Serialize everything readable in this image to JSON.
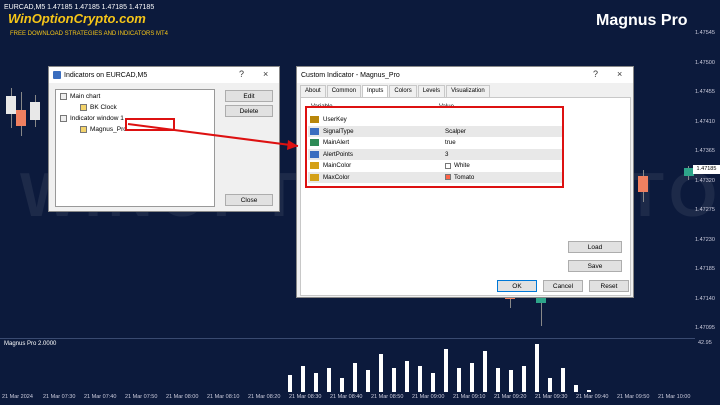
{
  "chart": {
    "symbol_line": "EURCAD,M5  1.47185 1.47185 1.47185 1.47185",
    "brand": "WinOptionCrypto.com",
    "brand_sub": "FREE DOWNLOAD STRATEGIES AND INDICATORS MT4",
    "product": "Magnus Pro",
    "watermark": "WINOPTIONCRYPTO.COM",
    "current_price": "1.47185",
    "price_labels": [
      "1.47545",
      "1.47500",
      "1.47455",
      "1.47410",
      "1.47365",
      "1.47320",
      "1.47275",
      "1.47230",
      "1.47185",
      "1.47140",
      "1.47095"
    ],
    "time_labels": [
      "21 Mar 2024",
      "21 Mar 07:30",
      "21 Mar 07:40",
      "21 Mar 07:50",
      "21 Mar 08:00",
      "21 Mar 08:10",
      "21 Mar 08:20",
      "21 Mar 08:30",
      "21 Mar 08:40",
      "21 Mar 08:50",
      "21 Mar 09:00",
      "21 Mar 09:10",
      "21 Mar 09:20",
      "21 Mar 09:30",
      "21 Mar 09:40",
      "21 Mar 09:50",
      "21 Mar 10:00"
    ],
    "subwindow_title": "Magnus Pro 2.0000",
    "subwindow_max": "42.95",
    "histogram_values": [
      0.35,
      0.55,
      0.4,
      0.5,
      0.3,
      0.6,
      0.45,
      0.8,
      0.5,
      0.65,
      0.55,
      0.4,
      0.9,
      0.5,
      0.6,
      0.85,
      0.5,
      0.45,
      0.55,
      1.0,
      0.3,
      0.5,
      0.15,
      0.05
    ]
  },
  "indicators_dialog": {
    "title": "Indicators on EURCAD,M5",
    "help": "?",
    "close": "×",
    "tree": [
      {
        "label": "Main chart"
      },
      {
        "label": "BK Clock"
      },
      {
        "label": "Indicator window 1"
      },
      {
        "label": "Magnus_Pro"
      }
    ],
    "edit_label": "Edit",
    "delete_label": "Delete",
    "close_label": "Close"
  },
  "custom_dialog": {
    "title": "Custom Indicator - Magnus_Pro",
    "help": "?",
    "close": "×",
    "tabs": [
      "About",
      "Common",
      "Inputs",
      "Colors",
      "Levels",
      "Visualization"
    ],
    "active_tab": "Inputs",
    "col_variable": "Variable",
    "col_value": "Value",
    "params": [
      {
        "name": "UserKey",
        "value": "",
        "icon": "abc",
        "icon_color": "#b8860b"
      },
      {
        "name": "SignalType",
        "value": "Scalper",
        "icon": "123",
        "icon_color": "#3a6dbf"
      },
      {
        "name": "MainAlert",
        "value": "true",
        "icon": "bool",
        "icon_color": "#2e8b57"
      },
      {
        "name": "AlertPoints",
        "value": "3",
        "icon": "123",
        "icon_color": "#3a6dbf"
      },
      {
        "name": "MainColor",
        "value": "White",
        "icon": "color",
        "icon_color": "#d4a017",
        "swatch": "#ffffff"
      },
      {
        "name": "MaxColor",
        "value": "Tomato",
        "icon": "color",
        "icon_color": "#d4a017",
        "swatch": "#ff6347"
      }
    ],
    "load_label": "Load",
    "save_label": "Save",
    "ok_label": "OK",
    "cancel_label": "Cancel",
    "reset_label": "Reset"
  }
}
